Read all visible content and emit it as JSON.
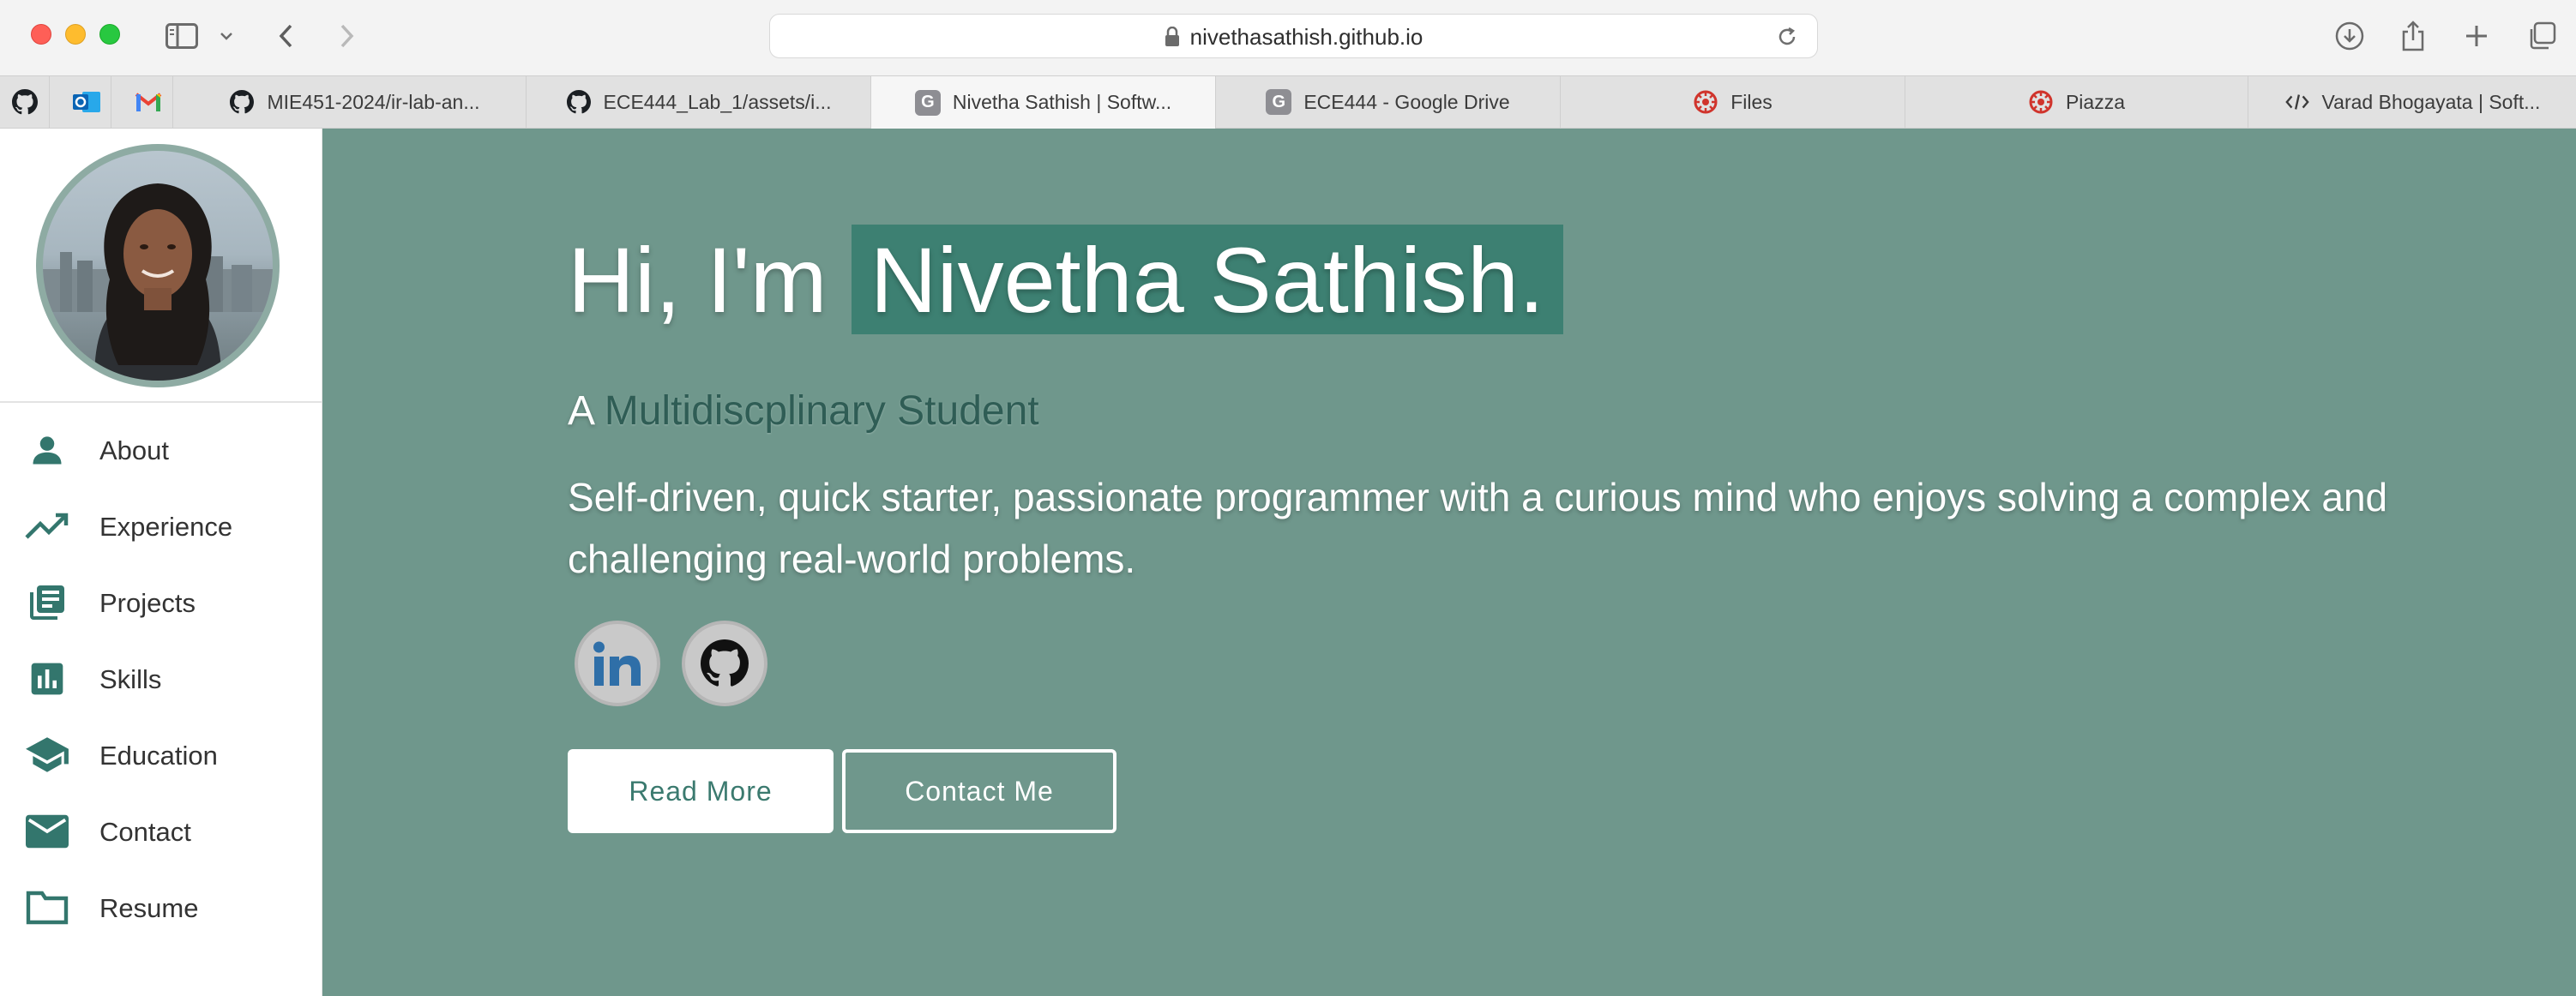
{
  "browser": {
    "url": "nivethasathish.github.io",
    "tabs": [
      {
        "label": "MIE451-2024/ir-lab-an...",
        "favicon": "github-icon"
      },
      {
        "label": "ECE444_Lab_1/assets/i...",
        "favicon": "github-icon"
      },
      {
        "label": "Nivetha Sathish | Softw...",
        "favicon": "g-icon",
        "active": true
      },
      {
        "label": "ECE444 - Google Drive",
        "favicon": "g-icon"
      },
      {
        "label": "Files",
        "favicon": "quercus-icon"
      },
      {
        "label": "Piazza",
        "favicon": "quercus-icon"
      },
      {
        "label": "Varad Bhogayata | Soft...",
        "favicon": "code-icon"
      }
    ],
    "pinned": [
      "github-icon",
      "outlook-icon",
      "gmail-icon"
    ],
    "g_letter": "G"
  },
  "sidebar": {
    "items": [
      {
        "label": "About",
        "icon": "person-icon"
      },
      {
        "label": "Experience",
        "icon": "trending-up-icon"
      },
      {
        "label": "Projects",
        "icon": "library-books-icon"
      },
      {
        "label": "Skills",
        "icon": "bar-chart-icon"
      },
      {
        "label": "Education",
        "icon": "school-icon"
      },
      {
        "label": "Contact",
        "icon": "mail-icon"
      },
      {
        "label": "Resume",
        "icon": "folder-icon"
      }
    ]
  },
  "hero": {
    "greeting_prefix": "Hi, I'm",
    "name": "Nivetha Sathish.",
    "subtitle_prefix": "A",
    "subtitle_role": "Multidiscplinary Student",
    "description": "Self-driven, quick starter, passionate programmer with a curious mind who enjoys solving a complex and challenging real-world problems.",
    "read_more": "Read More",
    "contact_me": "Contact Me",
    "social": [
      "linkedin-icon",
      "github-icon"
    ]
  },
  "colors": {
    "hero_bg": "#6f978c",
    "name_highlight": "#3d8072",
    "accent": "#33766d"
  }
}
